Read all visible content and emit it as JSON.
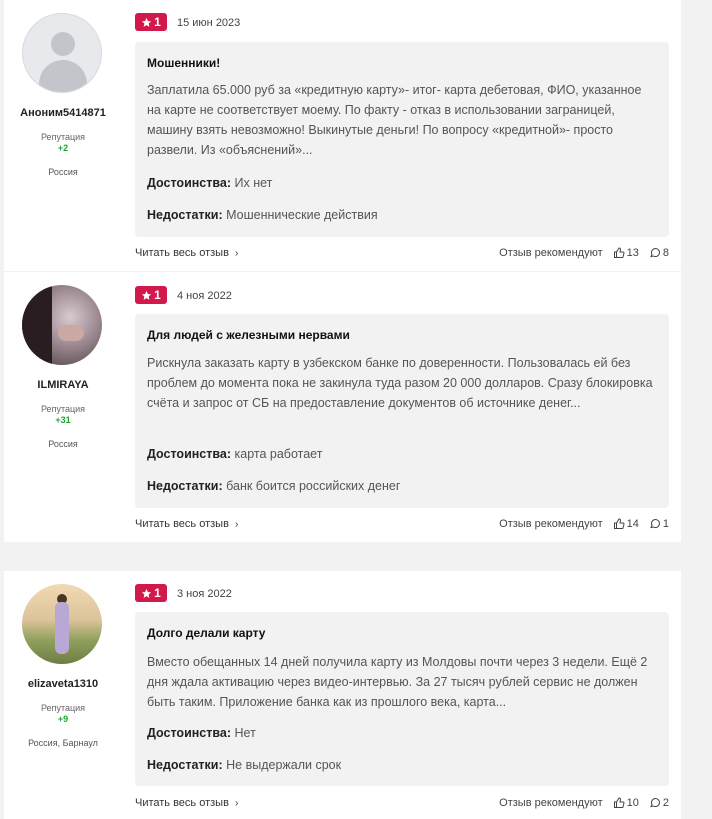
{
  "reviews": [
    {
      "user": {
        "name": "Аноним5414871",
        "rep_label": "Репутация",
        "rep_value": "+2",
        "location": "Россия",
        "avatar": "default-user-icon"
      },
      "rating": "1",
      "date": "15 июн 2023",
      "title": "Мошенники!",
      "text": "Заплатила 65.000 руб за «кредитную карту»- итог- карта дебетовая, ФИО, указанное на карте не соответствует моему. По факту - отказ в использовании заграницей, машину взять невозможно! Выкинутые деньги! По вопросу «кредитной»- просто развели. Из «объяснений»...",
      "pros_label": "Достоинства:",
      "pros": "Их нет",
      "cons_label": "Недостатки:",
      "cons": "Мошеннические действия",
      "read_more": "Читать весь отзыв",
      "recommends": "Отзыв рекомендуют",
      "likes": "13",
      "comments": "8"
    },
    {
      "user": {
        "name": "ILMIRAYA",
        "rep_label": "Репутация",
        "rep_value": "+31",
        "location": "Россия",
        "avatar": "photo"
      },
      "rating": "1",
      "date": "4 ноя 2022",
      "title": "Для людей с железными нервами",
      "text": "Рискнула заказать карту в узбекском банке по доверенности. Пользовалась ей без проблем до момента пока не закинула туда разом 20 000 долларов. Сразу блокировка счёта и запрос от СБ на предоставление документов об источнике денег...",
      "pros_label": "Достоинства:",
      "pros": "карта работает",
      "cons_label": "Недостатки:",
      "cons": "банк боится российских денег",
      "read_more": "Читать весь отзыв",
      "recommends": "Отзыв рекомендуют",
      "likes": "14",
      "comments": "1"
    },
    {
      "user": {
        "name": "elizaveta1310",
        "rep_label": "Репутация",
        "rep_value": "+9",
        "location": "Россия, Барнаул",
        "avatar": "photo"
      },
      "rating": "1",
      "date": "3 ноя 2022",
      "title": "Долго делали карту",
      "text": "Вместо обещанных 14 дней получила карту из Молдовы почти через 3 недели. Ещё 2 дня ждала активацию через видео-интервью. За 27 тысяч рублей сервис не должен быть таким. Приложение банка как из прошлого века, карта...",
      "pros_label": "Достоинства:",
      "pros": "Нет",
      "cons_label": "Недостатки:",
      "cons": "Не выдержали срок",
      "read_more": "Читать весь отзыв",
      "recommends": "Отзыв рекомендуют",
      "likes": "10",
      "comments": "2"
    }
  ],
  "colors": {
    "rating_badge": "#d3194b",
    "reputation": "#22a336",
    "bubble": "#f2f2f2"
  }
}
